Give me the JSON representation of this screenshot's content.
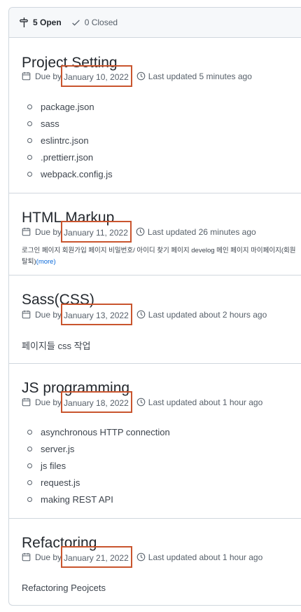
{
  "header": {
    "open_label": "5 Open",
    "closed_label": "0 Closed"
  },
  "milestones": [
    {
      "title": "Project Setting",
      "due_prefix": "Due by",
      "due_date": "January 10, 2022",
      "updated": "Last updated 5 minutes ago",
      "items": [
        "package.json",
        "sass",
        "eslintrc.json",
        ".prettierr.json",
        "webpack.config.js"
      ]
    },
    {
      "title": "HTML Markup",
      "due_prefix": "Due by",
      "due_date": "January 11, 2022",
      "updated": "Last updated 26 minutes ago",
      "description": "로그인 페이지 회원가입 페이지 비밀번호/ 아이디 찾기 페이지 develog 메인 페이지 마이페이지(회원탈퇴)",
      "more_label": "(more)"
    },
    {
      "title": "Sass(CSS)",
      "due_prefix": "Due by",
      "due_date": "January 13, 2022",
      "updated": "Last updated about 2 hours ago",
      "description": "페이지들 css 작업"
    },
    {
      "title": "JS programming",
      "due_prefix": "Due by",
      "due_date": "January 18, 2022",
      "updated": "Last updated about 1 hour ago",
      "items": [
        "asynchronous HTTP connection",
        "server.js",
        "js files",
        "request.js",
        "making REST API"
      ]
    },
    {
      "title": "Refactoring",
      "due_prefix": "Due by",
      "due_date": "January 21, 2022",
      "updated": "Last updated about 1 hour ago",
      "description": "Refactoring Peojcets"
    }
  ],
  "colors": {
    "highlight_box": "#c9552e",
    "border": "#d0d7de",
    "link": "#0969da"
  }
}
